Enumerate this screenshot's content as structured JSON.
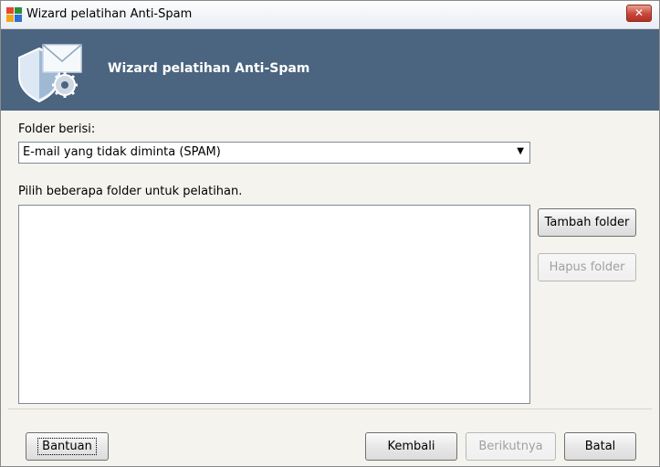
{
  "window": {
    "title": "Wizard pelatihan Anti-Spam",
    "close_label": "✕"
  },
  "banner": {
    "title": "Wizard pelatihan Anti-Spam"
  },
  "form": {
    "folder_label": "Folder berisi:",
    "folder_selected": "E-mail yang tidak diminta (SPAM)",
    "list_label": "Pilih beberapa folder untuk pelatihan.",
    "folders": []
  },
  "side_buttons": {
    "add_label": "Tambah folder",
    "remove_label": "Hapus folder"
  },
  "footer": {
    "help_label": "Bantuan",
    "back_label": "Kembali",
    "next_label": "Berikutnya",
    "cancel_label": "Batal"
  },
  "colors": {
    "banner": "#4b647f",
    "close_button": "#c8463a"
  },
  "icons": {
    "app": "avg-logo-icon",
    "banner": "shield-mail-gear-icon",
    "dropdown": "chevron-down-icon",
    "close": "close-icon"
  }
}
